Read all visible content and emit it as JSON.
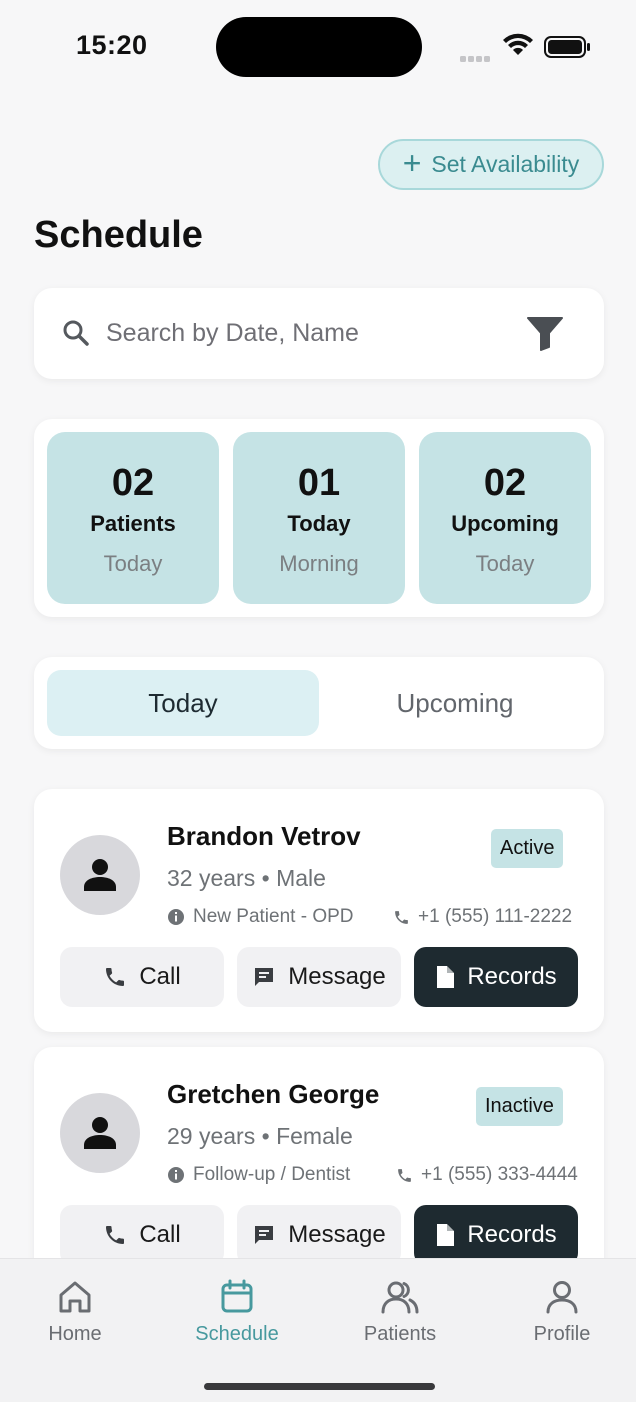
{
  "status_bar": {
    "time": "15:20"
  },
  "header": {
    "set_availability_label": "Set Availability",
    "title": "Schedule"
  },
  "search": {
    "placeholder": "Search by Date, Name"
  },
  "stats": [
    {
      "number": "02",
      "label": "Patients",
      "sub": "Today"
    },
    {
      "number": "01",
      "label": "Today",
      "sub": "Morning"
    },
    {
      "number": "02",
      "label": "Upcoming",
      "sub": "Today"
    }
  ],
  "tabs": {
    "today": "Today",
    "upcoming": "Upcoming"
  },
  "patients": [
    {
      "name": "Brandon Vetrov",
      "age": "32 years",
      "gender": "Male",
      "type": "New Patient - OPD",
      "phone": "+1 (555) 111-2222",
      "status": "Active"
    },
    {
      "name": "Gretchen George",
      "age": "29 years",
      "gender": "Female",
      "type": "Follow-up / Dentist",
      "phone": "+1 (555) 333-4444",
      "status": "Inactive"
    }
  ],
  "actions": {
    "call": "Call",
    "message": "Message",
    "records": "Records"
  },
  "nav": {
    "home": "Home",
    "schedule": "Schedule",
    "patients": "Patients",
    "profile": "Profile"
  },
  "colors": {
    "accent": "#47999e",
    "stat_bg": "#c5e3e5",
    "records_bg": "#1e2a30",
    "tab_active_bg": "#dcf0f3"
  }
}
